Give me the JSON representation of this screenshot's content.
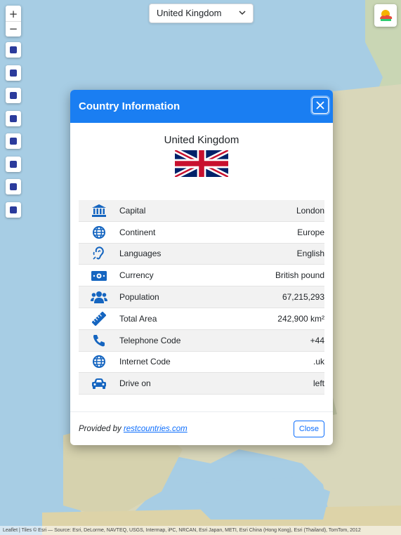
{
  "map": {
    "zoom_in": "+",
    "zoom_out": "−",
    "easy_buttons": [
      "star-icon",
      "info-icon",
      "camera-icon",
      "plane-icon",
      "news-icon",
      "film-icon",
      "landmark-icon",
      "earth-icon"
    ],
    "attribution": "Leaflet | Tiles © Esri — Source: Esri, DeLorme, NAVTEQ, USGS, Intermap, iPC, NRCAN, Esri Japan, METI, Esri China (Hong Kong), Esri (Thailand), TomTom, 2012"
  },
  "country_select": {
    "value": "United Kingdom"
  },
  "modal": {
    "title": "Country Information",
    "country_name": "United Kingdom",
    "rows": [
      {
        "icon": "landmark-icon",
        "label": "Capital",
        "value": "London"
      },
      {
        "icon": "globe-icon",
        "label": "Continent",
        "value": "Europe"
      },
      {
        "icon": "ear-icon",
        "label": "Languages",
        "value": "English"
      },
      {
        "icon": "money-bill-icon",
        "label": "Currency",
        "value": "British pound"
      },
      {
        "icon": "users-icon",
        "label": "Population",
        "value": "67,215,293"
      },
      {
        "icon": "ruler-icon",
        "label": "Total Area",
        "value": "242,900 km²"
      },
      {
        "icon": "phone-icon",
        "label": "Telephone Code",
        "value": "+44"
      },
      {
        "icon": "globe-icon",
        "label": "Internet Code",
        "value": ".uk"
      },
      {
        "icon": "car-icon",
        "label": "Drive on",
        "value": "left"
      }
    ],
    "provided_prefix": "Provided by ",
    "provided_link": "restcountries.com",
    "close_label": "Close"
  },
  "colors": {
    "header": "#1a7ef2",
    "icon": "#1565c0",
    "link": "#0d6efd"
  }
}
